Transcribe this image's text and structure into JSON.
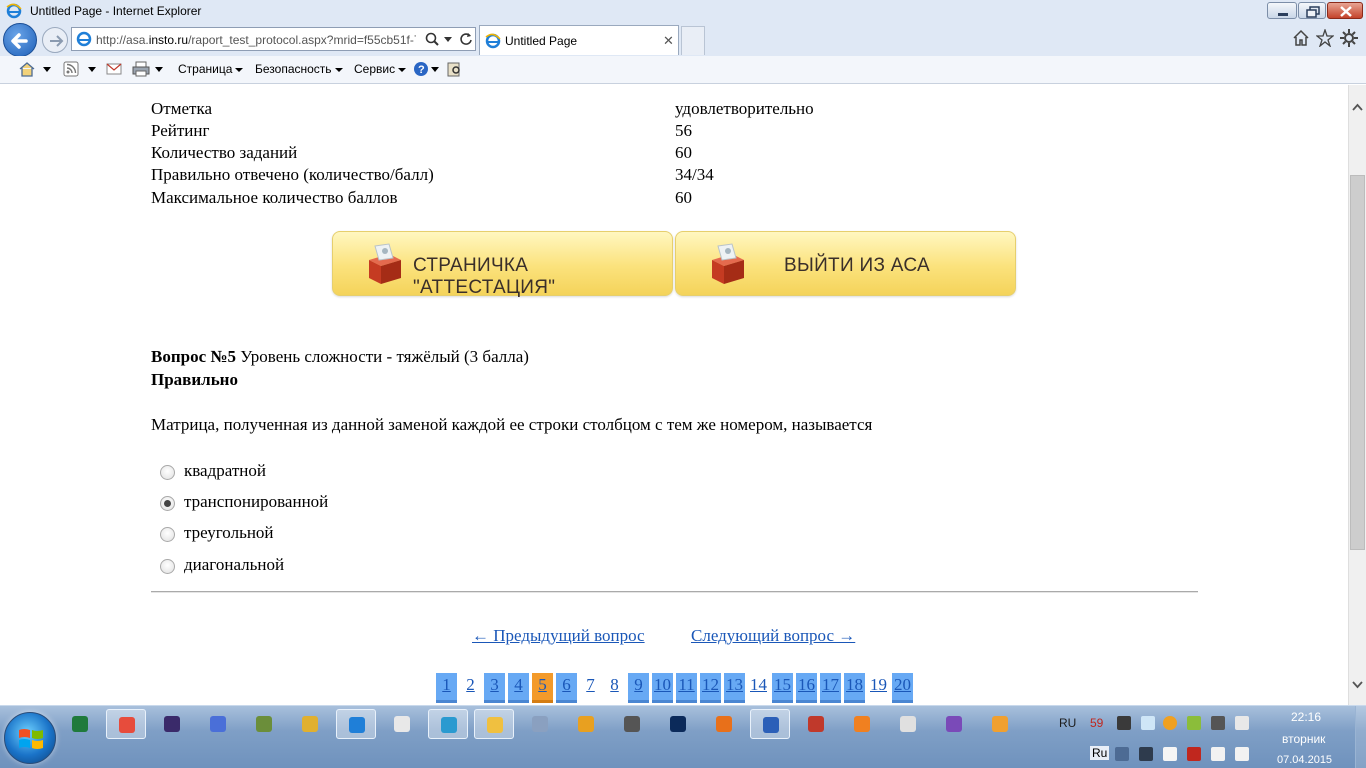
{
  "window": {
    "title": "Untitled Page - Internet Explorer",
    "address_prefix": "http://asa.",
    "address_domain": "insto.ru",
    "address_path": "/raport_test_protocol.aspx?mrid=f55cb51f-7",
    "tab_title": "Untitled Page"
  },
  "command_bar": {
    "page": "Страница",
    "safety": "Безопасность",
    "tools": "Сервис"
  },
  "summary": [
    {
      "label": "Отметка",
      "value": "удовлетворительно"
    },
    {
      "label": "Рейтинг",
      "value": "56"
    },
    {
      "label": "Количество заданий",
      "value": "60"
    },
    {
      "label": "Правильно отвечено (количество/балл)",
      "value": "34/34"
    },
    {
      "label": "Максимальное количество баллов",
      "value": "60"
    }
  ],
  "buttons": {
    "attestation": "СТРАНИЧКА \"АТТЕСТАЦИЯ\"",
    "exit": "ВЫЙТИ ИЗ АСА"
  },
  "question": {
    "number_label": "Вопрос №5",
    "difficulty": " Уровень сложности - тяжёлый (3 балла)",
    "status": "Правильно",
    "text": "Матрица, полученная из данной заменой каждой ее строки столбцом с тем же номером, называется",
    "options": [
      {
        "label": "квадратной",
        "selected": false
      },
      {
        "label": "транспонированной",
        "selected": true
      },
      {
        "label": "треугольной",
        "selected": false
      },
      {
        "label": "диагональной",
        "selected": false
      }
    ]
  },
  "navigation": {
    "prev": "← Предыдущий вопрос",
    "next": "Следующий вопрос →"
  },
  "pages": [
    {
      "n": "1",
      "state": "blue"
    },
    {
      "n": "2",
      "state": "none"
    },
    {
      "n": "3",
      "state": "blue"
    },
    {
      "n": "4",
      "state": "blue"
    },
    {
      "n": "5",
      "state": "current"
    },
    {
      "n": "6",
      "state": "blue"
    },
    {
      "n": "7",
      "state": "none"
    },
    {
      "n": "8",
      "state": "none"
    },
    {
      "n": "9",
      "state": "blue"
    },
    {
      "n": "10",
      "state": "blue"
    },
    {
      "n": "11",
      "state": "blue"
    },
    {
      "n": "12",
      "state": "blue"
    },
    {
      "n": "13",
      "state": "blue"
    },
    {
      "n": "14",
      "state": "none"
    },
    {
      "n": "15",
      "state": "blue"
    },
    {
      "n": "16",
      "state": "blue"
    },
    {
      "n": "17",
      "state": "blue"
    },
    {
      "n": "18",
      "state": "blue"
    },
    {
      "n": "19",
      "state": "none"
    },
    {
      "n": "20",
      "state": "blue"
    }
  ],
  "taskbar": {
    "apps": [
      "excel-icon",
      "chrome-icon",
      "media-icon",
      "d-app-icon",
      "tree-icon",
      "notes-icon",
      "ie-icon",
      "wifi-app-icon",
      "screen-icon",
      "explorer-icon",
      "audio-icon",
      "triangle-app-icon",
      "camera-icon",
      "photoshop-icon",
      "firefox-icon",
      "word-icon",
      "burn-icon",
      "two-app-icon",
      "calc-icon",
      "vs-icon",
      "player-icon"
    ],
    "lang_top": "RU",
    "badge": "59",
    "lang_bottom": "Ru",
    "time": "22:16",
    "weekday": "вторник",
    "date": "07.04.2015"
  },
  "colors": {
    "page_current": "#f39a2a",
    "page_visited": "#67a9f4",
    "link": "#1a57b8",
    "button_yellow": "#fbe27c"
  }
}
